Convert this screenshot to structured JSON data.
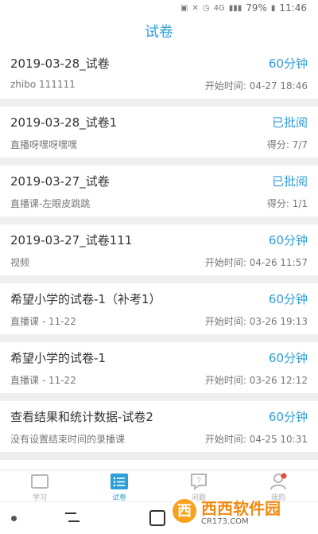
{
  "status_bar": {
    "battery": "79%",
    "time": "11:46",
    "network": "4G"
  },
  "header": {
    "title": "试卷"
  },
  "papers": [
    {
      "name": "2019-03-28_试卷",
      "badge": "60分钟",
      "source": "zhibo 111111",
      "meta": "开始时间: 04-27 18:46"
    },
    {
      "name": "2019-03-28_试卷1",
      "badge": "已批阅",
      "source": "直播呀嘿呀嘿嘿",
      "meta": "得分: 7/7"
    },
    {
      "name": "2019-03-27_试卷",
      "badge": "已批阅",
      "source": "直播课-左眼皮跳跳",
      "meta": "得分: 1/1"
    },
    {
      "name": "2019-03-27_试卷111",
      "badge": "60分钟",
      "source": "视频",
      "meta": "开始时间: 04-26 11:57"
    },
    {
      "name": "希望小学的试卷-1（补考1）",
      "badge": "60分钟",
      "source": "直播课 - 11-22",
      "meta": "开始时间: 03-26 19:13"
    },
    {
      "name": "希望小学的试卷-1",
      "badge": "60分钟",
      "source": "直播课 - 11-22",
      "meta": "开始时间: 03-26 12:12"
    },
    {
      "name": "查看结果和统计数据-试卷2",
      "badge": "60分钟",
      "source": "没有设置结束时间的录播课",
      "meta": "开始时间: 04-25 10:31"
    }
  ],
  "tabs": [
    {
      "label": "学习",
      "icon": "book-icon"
    },
    {
      "label": "试卷",
      "icon": "list-icon"
    },
    {
      "label": "问题",
      "icon": "question-icon"
    },
    {
      "label": "我的",
      "icon": "user-icon"
    }
  ],
  "watermark": {
    "badge": "西",
    "text": "西西软件园",
    "site": "CR173.COM"
  },
  "colors": {
    "accent": "#2e9fd8",
    "background": "#efefef",
    "watermark": "#f28a12"
  }
}
